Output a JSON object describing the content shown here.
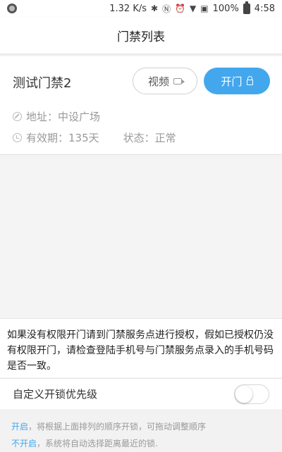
{
  "status_bar": {
    "speed": "1.32 K/s",
    "battery": "100%",
    "time": "4:58",
    "icons": [
      "bluetooth-icon",
      "nfc-icon",
      "alarm-icon",
      "wifi-icon",
      "no-sim-icon",
      "battery-icon"
    ]
  },
  "header": {
    "title": "门禁列表"
  },
  "door": {
    "name": "测试门禁2",
    "video_label": "视频",
    "open_label": "开门",
    "address": "地址：中设广场",
    "validity": "有效期：135天",
    "status": "状态：正常"
  },
  "notice": {
    "text": "如果没有权限开门请到门禁服务点进行授权，假如已授权仍没有权限开门，请检查登陆手机号与门禁服务点录入的手机号码是否一致。"
  },
  "setting": {
    "label": "自定义开锁优先级",
    "toggle_on": false
  },
  "help": {
    "on_keyword": "开启",
    "on_text": "，将根据上面排列的顺序开锁，可拖动调整顺序",
    "off_keyword": "不开启",
    "off_text": "，系统将自动选择距离最近的锁."
  },
  "colors": {
    "accent": "#43a7ee",
    "background": "#f4f4f4"
  }
}
